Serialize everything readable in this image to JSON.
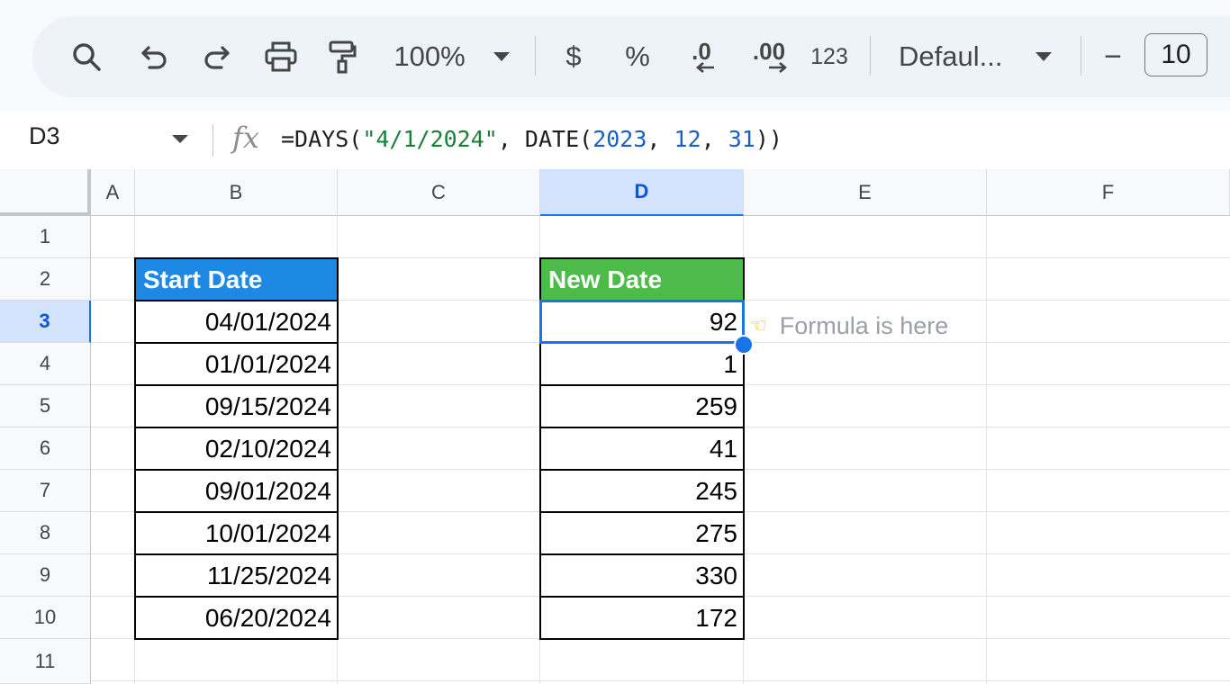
{
  "toolbar": {
    "zoom": "100%",
    "currency": "$",
    "percent": "%",
    "decrease_decimal": ".0",
    "increase_decimal": ".00",
    "number_format": "123",
    "font": "Defaul...",
    "font_size_minus": "−",
    "font_size": "10"
  },
  "formula_bar": {
    "cell_ref": "D3",
    "fx": "fx",
    "formula_parts": [
      "=DAYS(",
      "\"4/1/2024\"",
      ", DATE(",
      "2023",
      ", ",
      "12",
      ", ",
      "31",
      "))"
    ]
  },
  "columns": [
    "A",
    "B",
    "C",
    "D",
    "E",
    "F"
  ],
  "rows": [
    "1",
    "2",
    "3",
    "4",
    "5",
    "6",
    "7",
    "8",
    "9",
    "10",
    "11"
  ],
  "table": {
    "start_header": "Start Date",
    "new_header": "New Date",
    "start_dates": [
      "04/01/2024",
      "01/01/2024",
      "09/15/2024",
      "02/10/2024",
      "09/01/2024",
      "10/01/2024",
      "11/25/2024",
      "06/20/2024"
    ],
    "new_dates": [
      "92",
      "1",
      "259",
      "41",
      "245",
      "275",
      "330",
      "172"
    ]
  },
  "note": {
    "icon": "pointing-hand-icon",
    "text": "Formula is here"
  }
}
